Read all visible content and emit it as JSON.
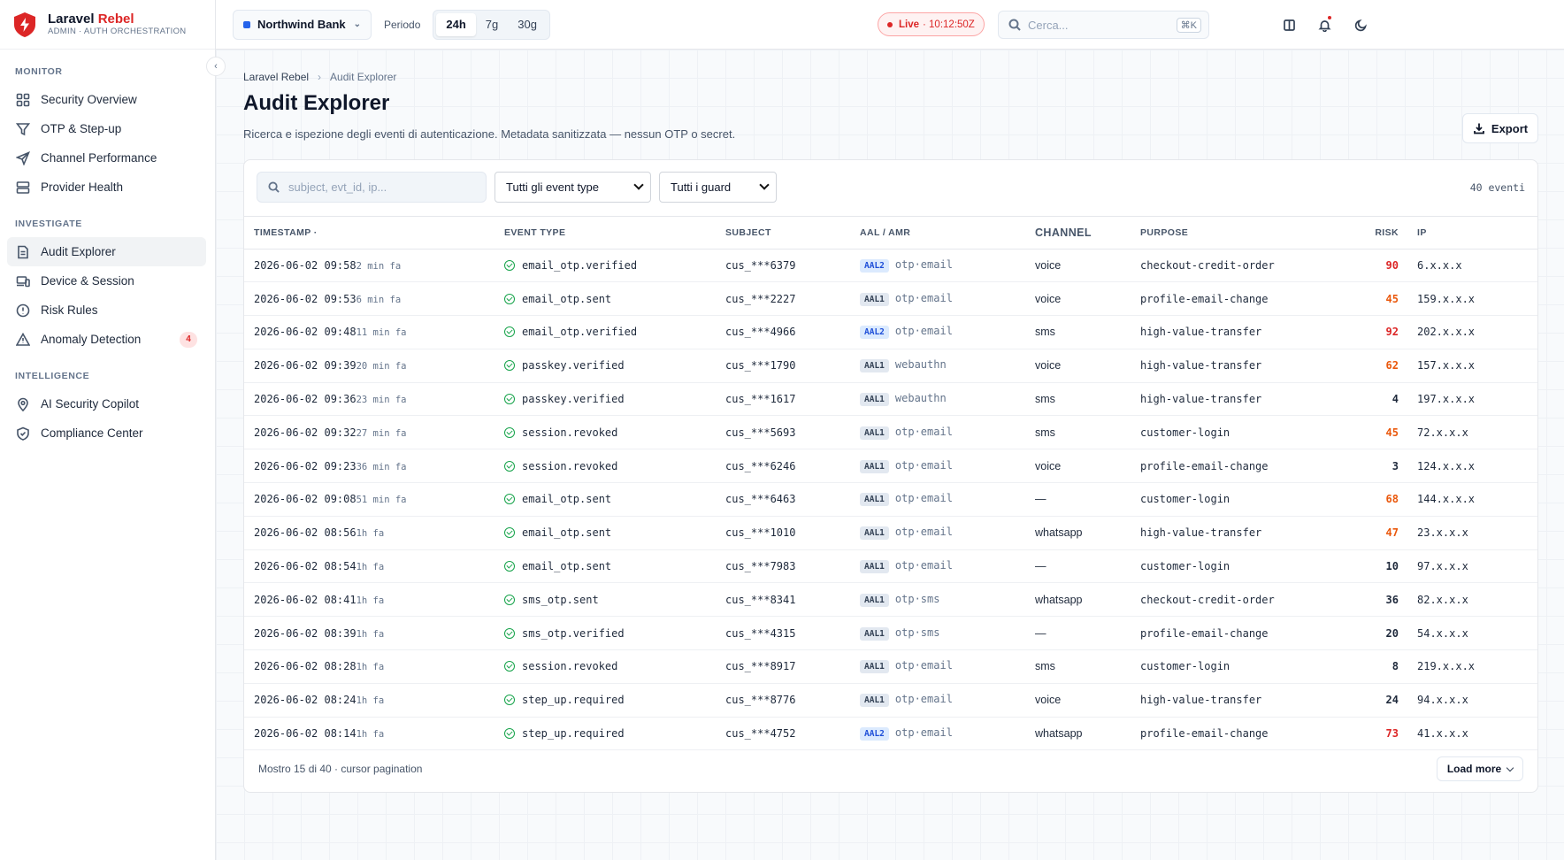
{
  "brand": {
    "name_a": "Laravel",
    "name_b": "Rebel",
    "subtitle": "ADMIN · AUTH ORCHESTRATION",
    "accent": "#dc2626"
  },
  "sidebar": {
    "sections": [
      {
        "title": "MONITOR",
        "items": [
          {
            "label": "Security Overview",
            "icon": "grid-icon"
          },
          {
            "label": "OTP & Step-up",
            "icon": "filter-icon"
          },
          {
            "label": "Channel Performance",
            "icon": "send-icon"
          },
          {
            "label": "Provider Health",
            "icon": "server-icon"
          }
        ]
      },
      {
        "title": "INVESTIGATE",
        "items": [
          {
            "label": "Audit Explorer",
            "icon": "document-icon",
            "active": true
          },
          {
            "label": "Device & Session",
            "icon": "devices-icon"
          },
          {
            "label": "Risk Rules",
            "icon": "alert-circle-icon"
          },
          {
            "label": "Anomaly Detection",
            "icon": "warning-triangle-icon",
            "badge": "4"
          }
        ]
      },
      {
        "title": "INTELLIGENCE",
        "items": [
          {
            "label": "AI Security Copilot",
            "icon": "location-pin-icon"
          },
          {
            "label": "Compliance Center",
            "icon": "shield-check-icon"
          }
        ]
      }
    ]
  },
  "topbar": {
    "tenant": "Northwind Bank",
    "period_label": "Periodo",
    "periods": [
      "24h",
      "7g",
      "30g"
    ],
    "active_period": "24h",
    "live_label": "Live",
    "live_time": "· 10:12:50Z",
    "search_placeholder": "Cerca...",
    "search_shortcut": "⌘K"
  },
  "page": {
    "breadcrumb": [
      "Laravel Rebel",
      "Audit Explorer"
    ],
    "title": "Audit Explorer",
    "subtitle": "Ricerca e ispezione degli eventi di autenticazione. Metadata sanitizzata — nessun OTP o secret.",
    "export_label": "Export"
  },
  "filters": {
    "search_placeholder": "subject, evt_id, ip...",
    "event_type": "Tutti gli event type",
    "guard": "Tutti i guard",
    "count": "40 eventi"
  },
  "table": {
    "columns": [
      "TIMESTAMP",
      "EVENT TYPE",
      "SUBJECT",
      "AAL / AMR",
      "CHANNEL",
      "PURPOSE",
      "RISK",
      "IP"
    ],
    "sort_indicator": "·",
    "rows": [
      {
        "ts": "2026-06-02 09:58",
        "ago": "2 min fa",
        "event": "email_otp.verified",
        "subject": "cus_***6379",
        "aal": "AAL2",
        "amr": "otp·email",
        "channel": "voice",
        "purpose": "checkout-credit-order",
        "risk": "90",
        "ip": "6.x.x.x"
      },
      {
        "ts": "2026-06-02 09:53",
        "ago": "6 min fa",
        "event": "email_otp.sent",
        "subject": "cus_***2227",
        "aal": "AAL1",
        "amr": "otp·email",
        "channel": "voice",
        "purpose": "profile-email-change",
        "risk": "45",
        "ip": "159.x.x.x"
      },
      {
        "ts": "2026-06-02 09:48",
        "ago": "11 min fa",
        "event": "email_otp.verified",
        "subject": "cus_***4966",
        "aal": "AAL2",
        "amr": "otp·email",
        "channel": "sms",
        "purpose": "high-value-transfer",
        "risk": "92",
        "ip": "202.x.x.x"
      },
      {
        "ts": "2026-06-02 09:39",
        "ago": "20 min fa",
        "event": "passkey.verified",
        "subject": "cus_***1790",
        "aal": "AAL1",
        "amr": "webauthn",
        "channel": "voice",
        "purpose": "high-value-transfer",
        "risk": "62",
        "ip": "157.x.x.x"
      },
      {
        "ts": "2026-06-02 09:36",
        "ago": "23 min fa",
        "event": "passkey.verified",
        "subject": "cus_***1617",
        "aal": "AAL1",
        "amr": "webauthn",
        "channel": "sms",
        "purpose": "high-value-transfer",
        "risk": "4",
        "ip": "197.x.x.x"
      },
      {
        "ts": "2026-06-02 09:32",
        "ago": "27 min fa",
        "event": "session.revoked",
        "subject": "cus_***5693",
        "aal": "AAL1",
        "amr": "otp·email",
        "channel": "sms",
        "purpose": "customer-login",
        "risk": "45",
        "ip": "72.x.x.x"
      },
      {
        "ts": "2026-06-02 09:23",
        "ago": "36 min fa",
        "event": "session.revoked",
        "subject": "cus_***6246",
        "aal": "AAL1",
        "amr": "otp·email",
        "channel": "voice",
        "purpose": "profile-email-change",
        "risk": "3",
        "ip": "124.x.x.x"
      },
      {
        "ts": "2026-06-02 09:08",
        "ago": "51 min fa",
        "event": "email_otp.sent",
        "subject": "cus_***6463",
        "aal": "AAL1",
        "amr": "otp·email",
        "channel": "—",
        "purpose": "customer-login",
        "risk": "68",
        "ip": "144.x.x.x"
      },
      {
        "ts": "2026-06-02 08:56",
        "ago": "1h fa",
        "event": "email_otp.sent",
        "subject": "cus_***1010",
        "aal": "AAL1",
        "amr": "otp·email",
        "channel": "whatsapp",
        "purpose": "high-value-transfer",
        "risk": "47",
        "ip": "23.x.x.x"
      },
      {
        "ts": "2026-06-02 08:54",
        "ago": "1h fa",
        "event": "email_otp.sent",
        "subject": "cus_***7983",
        "aal": "AAL1",
        "amr": "otp·email",
        "channel": "—",
        "purpose": "customer-login",
        "risk": "10",
        "ip": "97.x.x.x"
      },
      {
        "ts": "2026-06-02 08:41",
        "ago": "1h fa",
        "event": "sms_otp.sent",
        "subject": "cus_***8341",
        "aal": "AAL1",
        "amr": "otp·sms",
        "channel": "whatsapp",
        "purpose": "checkout-credit-order",
        "risk": "36",
        "ip": "82.x.x.x"
      },
      {
        "ts": "2026-06-02 08:39",
        "ago": "1h fa",
        "event": "sms_otp.verified",
        "subject": "cus_***4315",
        "aal": "AAL1",
        "amr": "otp·sms",
        "channel": "—",
        "purpose": "profile-email-change",
        "risk": "20",
        "ip": "54.x.x.x"
      },
      {
        "ts": "2026-06-02 08:28",
        "ago": "1h fa",
        "event": "session.revoked",
        "subject": "cus_***8917",
        "aal": "AAL1",
        "amr": "otp·email",
        "channel": "sms",
        "purpose": "customer-login",
        "risk": "8",
        "ip": "219.x.x.x"
      },
      {
        "ts": "2026-06-02 08:24",
        "ago": "1h fa",
        "event": "step_up.required",
        "subject": "cus_***8776",
        "aal": "AAL1",
        "amr": "otp·email",
        "channel": "voice",
        "purpose": "high-value-transfer",
        "risk": "24",
        "ip": "94.x.x.x"
      },
      {
        "ts": "2026-06-02 08:14",
        "ago": "1h fa",
        "event": "step_up.required",
        "subject": "cus_***4752",
        "aal": "AAL2",
        "amr": "otp·email",
        "channel": "whatsapp",
        "purpose": "profile-email-change",
        "risk": "73",
        "ip": "41.x.x.x"
      }
    ]
  },
  "footer": {
    "showing": "Mostro 15 di 40 · cursor pagination",
    "load_more": "Load more"
  }
}
